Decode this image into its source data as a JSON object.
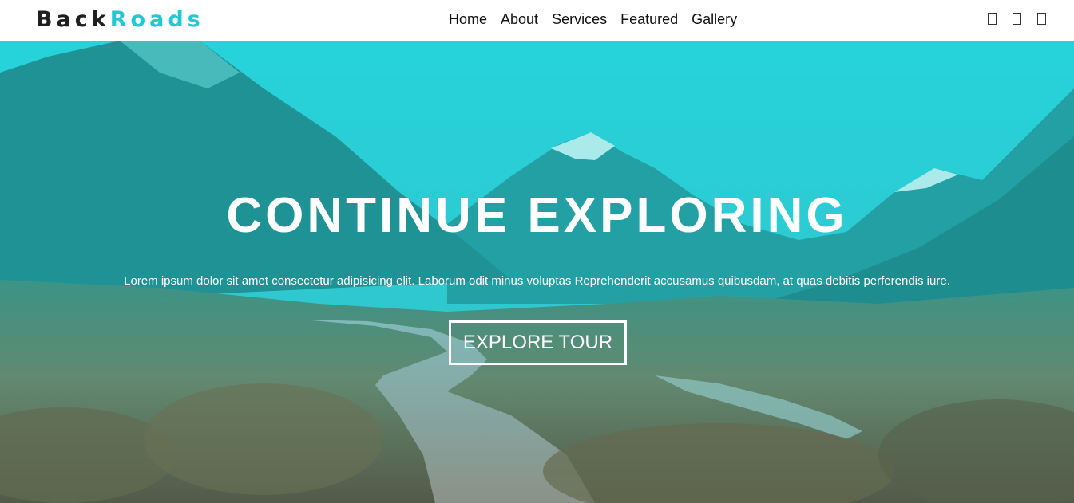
{
  "brand": {
    "part1": "Back",
    "part2": "Roads",
    "accent_color": "#1ecad3"
  },
  "nav": {
    "items": [
      {
        "label": "Home"
      },
      {
        "label": "About"
      },
      {
        "label": "Services"
      },
      {
        "label": "Featured"
      },
      {
        "label": "Gallery"
      }
    ]
  },
  "social": {
    "icons": [
      "facebook-icon",
      "twitter-icon",
      "squarespace-icon"
    ]
  },
  "hero": {
    "title": "CONTINUE EXPLORING",
    "text": "Lorem ipsum dolor sit amet consectetur adipisicing elit. Laborum odit minus voluptas Reprehenderit accusamus quibusdam, at quas debitis perferendis iure.",
    "button_label": "EXPLORE TOUR",
    "overlay_color": "#1ecad3"
  }
}
